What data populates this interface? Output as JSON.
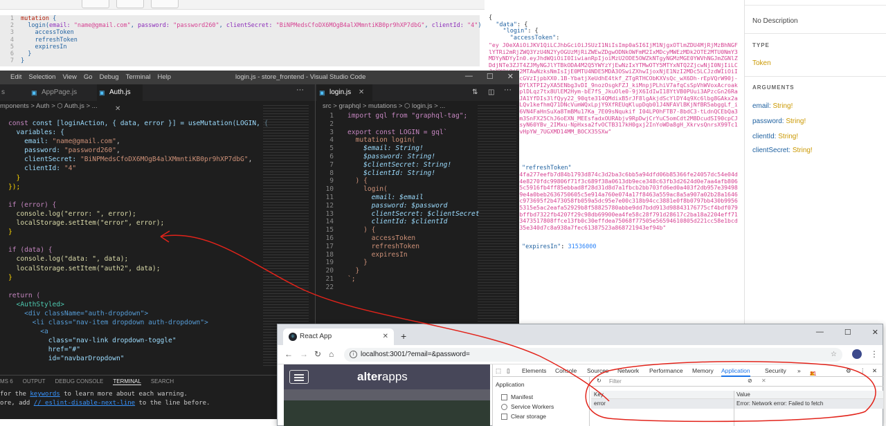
{
  "graphiql": {
    "query_lines": [
      "1",
      "2",
      "3",
      "4",
      "5",
      "6",
      "7"
    ],
    "query": {
      "kw": "mutation",
      "fn": "login",
      "email_arg": "email:",
      "email_val": "\"name@gmail.com\"",
      "password_arg": "password:",
      "password_val": "\"password260\"",
      "secret_arg": "clientSecret:",
      "secret_val": "\"BiNPMedsCfoDX6MOgB4alXMmntiKB0pr9hXP7dbG\"",
      "client_arg": "clientId:",
      "client_val": "\"4\"",
      "f1": "accessToken",
      "f2": "refreshToken",
      "f3": "expiresIn"
    },
    "result": {
      "data_key": "\"data\"",
      "login_key": "\"login\"",
      "access_key": "\"accessToken\"",
      "access_val": "\"ey J0eXAiOiJKV1QiLCJhbGciOiJSUzI1NiIsImp0aSI6IjM1NjgxOTlmZDU4MjRjMzBhNGFlYTRi2mRjZWQ3YzU4N2YyOGUzMjRiZWEwZDgwODNkOWFmM2IxMDcyMWEzMDk2OTE2MTU0NmY3MDYyNDYyIn0.eyJhdWQiOiI0IiwianRpIjoiMzU2ODE5OWZkNTgyNGMzMGE0YWVhNGJmZGNlZDdjNTe3ZJT4ZJMyNGJlYTBkODA4M2Q5YWYzYjEwNzIxYTMwOTY5MTYxNTQ2ZjcwNjI0NjIiLCJpYXQiOjE2MTAwNzksNmIsIjE0MTU4NDE5MDA3OSwiZXhwIjoxNjE1NzI2MDc5LCJzdWIiOiIxIiwic2NvcGVzIjpbXX0.1B-YbatjXeUdhE4tkf_ZTgRTHCObKXVsQc_wX6Dh-rEpVQrW90j-ZoYjPTr6iDYlXTPI2yXA5ENbg3vDI_9nozOsgkFZJ_kiMnpjPLhiV7afqCsSpVhWVoxAcroakgxiiiSAk6plDLqz7tx8UlEM2Hym-bE7fS_JkuOle0-9jX6IdIwI18YtVB0PUui3APzcGn26Ra7ZFOvWvseJA1YfDIs3lfQyy22_90qte314QMdixB5rJF8lgAkjdScYlDY4q9Xc6lbg8GAkx2aU4tdfQ-GfLQv1kefhmQ71DNcVumWQxLpjY9XfREUqKlupDqb01J4NFAVlBKjNfBR5abggLf_iDMw0OM4186VN4FaHnSuXa8TmBMu17Ka_7E09sNqukif I04LP0hFTB7-8bdC3-tLdnQCEbQa3CdrHGOHfdm3SnFX25ChJ6oEXN_MEEsfadxOURAbjv9RpDwjCrYuC5omCdt2M8DcudSI90cpCJDCorRpjMRsyN60YBv_2IMxu-NpHxsa2fvOCTB317kH0gxj2InYoWDa8gH_XkrvsQnrsX99Tc1qxNBWE4UKvHpYW_7UGXMD14MM_BOCX35SXw\"",
      "refresh_key": "\"refreshToken\"",
      "refresh_val": "\"93a3cb794fa277eefb7d84b1793d874c3d2ba3c6bb5a94dfd06b85366fe24057dc54e04dbc782e9324e8270fdc99806f71f3c689f38a0613db9ece348c63fb3d2624d0e7aa4afb8069d398976c5c5916fb4ff85ebbad8f28d31d8d7a1fbcb2bb703fd6ed0a403f2db957e39498641c100229e4a0beb2636750605c5e914a760e074a17f8463a559ac8a5a907a02b28a1646d92d8cf3ec973695f2b473058fb059a5dc95e7e00c318b94cc3881e0f8b0797bb430b99560b767c4135315e5ac2eafa52929b8f58825780abbe9dd7bdd913d98843176775cf4bdf079ec9141f8cbffbd7322fb4207f29c98db69900ea4fe58c28f791d28617c2ba18a2204eff71605bc0d3a3473517808ffce13fb0c30effdea75068f77505e56594610805d221cc58e1bcd6833c0a1035e340d7c8a938a7fec61387523a868721943ef94b\"",
      "expires_key": "\"expiresIn\"",
      "expires_val": "31536000"
    }
  },
  "docs": {
    "description": "No Description",
    "type_caption": "TYPE",
    "type_value": "Token",
    "arguments_caption": "ARGUMENTS",
    "args": [
      {
        "name": "email:",
        "type": "String!"
      },
      {
        "name": "password:",
        "type": "String!"
      },
      {
        "name": "clientId:",
        "type": "String!"
      },
      {
        "name": "clientSecret:",
        "type": "String!"
      }
    ]
  },
  "vscode": {
    "menu": [
      "Edit",
      "Selection",
      "View",
      "Go",
      "Debug",
      "Terminal",
      "Help"
    ],
    "window_title": "login.js - store_frontend - Visual Studio Code",
    "tabs_left": [
      "s",
      "AppPage.js",
      "Auth.js"
    ],
    "tab_right": "login.js",
    "crumbs_left": "mponents > Auth > ⬡ Auth.js > ...",
    "crumbs_right": "src > graphql > mutations > ⬡ login.js > ...",
    "left_code": {
      "l1": "const [loginAction, { data, error }] = useMutation(LOGIN, {",
      "l2": "  variables: {",
      "l3a": "    email: ",
      "l3b": "\"name@gmail.com\"",
      "l4a": "    password: ",
      "l4b": "\"password260\"",
      "l5a": "    clientSecret: ",
      "l5b": "\"BiNPMedsCfoDX6MOgB4alXMmntiKB0pr9hXP7dbG\"",
      "l6a": "    clientId: ",
      "l6b": "\"4\"",
      "l7": "  }",
      "l8": "});",
      "l9": "if (error) {",
      "l10": "  console.log(\"error: \", error);",
      "l11": "  localStorage.setItem(\"error\", error);",
      "l12": "}",
      "l13": "if (data) {",
      "l14": "  console.log(\"data: \", data);",
      "l15": "  localStorage.setItem(\"auth2\", data);",
      "l16": "}",
      "l17": "return (",
      "l18": "  <AuthStyled>",
      "l19": "    <div className=\"auth-dropdown\">",
      "l20": "      <li class=\"nav-item dropdown auth-dropdown\">",
      "l21": "        <a",
      "l22": "          class=\"nav-link dropdown-toggle\"",
      "l23": "          href=\"#\"",
      "l24": "          id=\"navbarDropdown\""
    },
    "right_gutter": "1\n2\n3\n4\n5\n6\n7\n8\n9\n10\n11\n12\n13\n14\n15\n16\n17\n18\n19\n20\n21\n22",
    "right_code": {
      "r1": "import gql from \"graphql-tag\";",
      "r3": "export const LOGIN = gql`",
      "r4": "  mutation login(",
      "r5": "    $email: String!",
      "r6": "    $password: String!",
      "r7": "    $clientSecret: String!",
      "r8": "    $clientId: String!",
      "r9": "  ) {",
      "r10": "    login(",
      "r11": "      email: $email",
      "r12": "      password: $password",
      "r13": "      clientSecret: $clientSecret",
      "r14": "      clientId: $clientId",
      "r15": "    ) {",
      "r16": "      accessToken",
      "r17": "      refreshToken",
      "r18": "      expiresIn",
      "r19": "    }",
      "r20": "  }",
      "r21": "`;"
    },
    "panel_tabs": [
      "MS 6",
      "OUTPUT",
      "DEBUG CONSOLE",
      "TERMINAL",
      "SEARCH"
    ],
    "panel_line1a": "for the ",
    "panel_line1b": "keywords",
    "panel_line1c": " to learn more about each warning.",
    "panel_line2a": "ore, add ",
    "panel_line2b": "// eslint-disable-next-line",
    "panel_line2c": " to the line before."
  },
  "chrome": {
    "tab_title": "React App",
    "url": "localhost:3001/?email=&password=",
    "logo_a": "alter",
    "logo_b": "apps",
    "devtools_tabs": [
      "Elements",
      "Console",
      "Sources",
      "Network",
      "Performance",
      "Memory",
      "Application",
      "Security",
      "»"
    ],
    "errors": "21",
    "warnings": "8",
    "sidebar_title": "Application",
    "sidebar_items": [
      "Manifest",
      "Service Workers",
      "Clear storage"
    ],
    "filter_placeholder": "Filter",
    "col_key": "Key",
    "col_value": "Value",
    "row_key": "error",
    "row_value": "Error: Network error: Failed to fetch"
  },
  "colors": {
    "annotation": "#e2231a"
  }
}
